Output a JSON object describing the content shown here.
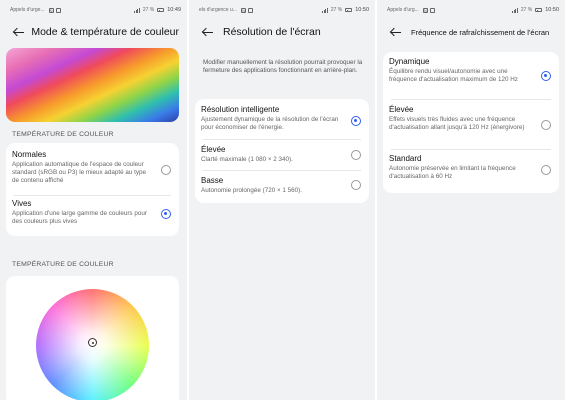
{
  "panel1": {
    "status": {
      "carrier": "Appels d'urge...",
      "battery": "27 %",
      "time": "10:49"
    },
    "title": "Mode & température de couleur",
    "section1": "TEMPÉRATURE DE COULEUR",
    "options": [
      {
        "title": "Normales",
        "desc": "Application automatique de l'espace de couleur standard (sRGB ou P3) le mieux adapté au type de contenu affiché",
        "selected": false
      },
      {
        "title": "Vives",
        "desc": "Application d'une large gamme de couleurs pour des couleurs plus vives",
        "selected": true
      }
    ],
    "section2": "TEMPÉRATURE DE COULEUR"
  },
  "panel2": {
    "status": {
      "carrier": "els d'urgence u...",
      "battery": "27 %",
      "time": "10:50"
    },
    "title": "Résolution de l'écran",
    "intro": "Modifier manuellement la résolution pourrait provoquer la fermeture des applications fonctionnant en arrière-plan.",
    "options": [
      {
        "title": "Résolution intelligente",
        "desc": "Ajustement dynamique de la résolution de l'écran pour économiser de l'énergie.",
        "selected": true
      },
      {
        "title": "Élevée",
        "desc": "Clarté maximale (1 080 × 2 340).",
        "selected": false
      },
      {
        "title": "Basse",
        "desc": "Autonomie prolongée (720 × 1 560).",
        "selected": false
      }
    ]
  },
  "panel3": {
    "status": {
      "carrier": "Appels d'urg...",
      "battery": "27 %",
      "time": "10:50"
    },
    "title": "Fréquence de rafraîchissement de l'écran",
    "options": [
      {
        "title": "Dynamique",
        "desc": "Équilibre rendu visuel/autonomie avec une fréquence d'actualisation maximum de 120 Hz",
        "selected": true
      },
      {
        "title": "Élevée",
        "desc": "Effets visuels très fluides avec une fréquence d'actualisation allant jusqu'à 120 Hz (énergivore)",
        "selected": false
      },
      {
        "title": "Standard",
        "desc": "Autonomie préservée en limitant la fréquence d'actualisation à 60 Hz",
        "selected": false
      }
    ]
  },
  "colors": {
    "accent": "#2f5ff2",
    "background": "#f1f2f4",
    "card": "#ffffff"
  }
}
